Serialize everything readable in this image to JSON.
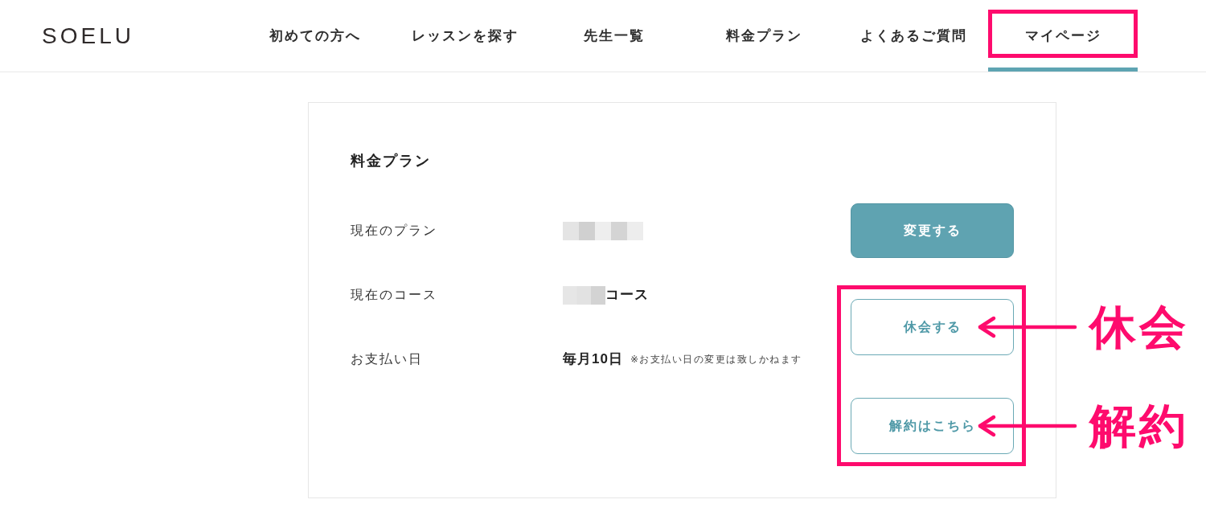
{
  "header": {
    "logo": "SOELU",
    "nav": [
      {
        "label": "初めての方へ",
        "selected": false,
        "highlighted": false
      },
      {
        "label": "レッスンを探す",
        "selected": false,
        "highlighted": false
      },
      {
        "label": "先生一覧",
        "selected": false,
        "highlighted": false
      },
      {
        "label": "料金プラン",
        "selected": false,
        "highlighted": false
      },
      {
        "label": "よくあるご質問",
        "selected": false,
        "highlighted": false
      },
      {
        "label": "マイページ",
        "selected": true,
        "highlighted": true
      }
    ]
  },
  "plan_card": {
    "title": "料金プラン",
    "rows": [
      {
        "label": "現在のプラン",
        "kind": "redacted"
      },
      {
        "label": "現在のコース",
        "kind": "partial",
        "value": "コース"
      },
      {
        "label": "お支払い日",
        "kind": "text",
        "value": "毎月10日",
        "note": "※お支払い日の変更は致しかねます"
      }
    ],
    "buttons": [
      {
        "label": "変更する",
        "kind": "filled",
        "highlighted": false
      },
      {
        "label": "休会する",
        "kind": "outline",
        "highlighted": true,
        "callout": "休会"
      },
      {
        "label": "解約はこちら",
        "kind": "outline",
        "highlighted": true,
        "callout": "解約"
      }
    ]
  }
}
